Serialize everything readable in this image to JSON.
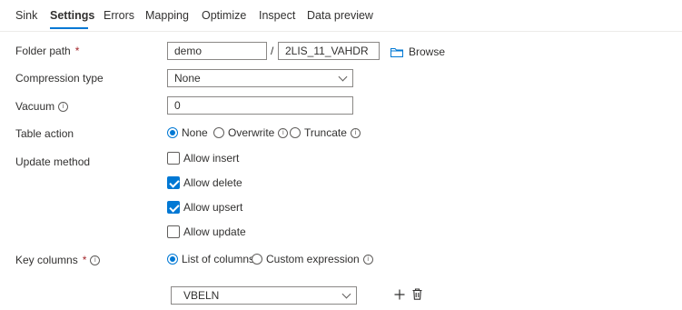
{
  "tabs": [
    {
      "label": "Sink"
    },
    {
      "label": "Settings"
    },
    {
      "label": "Errors"
    },
    {
      "label": "Mapping"
    },
    {
      "label": "Optimize"
    },
    {
      "label": "Inspect"
    },
    {
      "label": "Data preview"
    }
  ],
  "active_tab": "Settings",
  "folder_path": {
    "label": "Folder path",
    "required_mark": "*",
    "container_value": "demo",
    "separator": "/",
    "directory_value": "2LIS_11_VAHDR",
    "browse_label": "Browse"
  },
  "compression": {
    "label": "Compression type",
    "selected": "None"
  },
  "vacuum": {
    "label": "Vacuum",
    "value": "0"
  },
  "table_action": {
    "label": "Table action",
    "options": [
      {
        "label": "None",
        "selected": true
      },
      {
        "label": "Overwrite",
        "selected": false
      },
      {
        "label": "Truncate",
        "selected": false
      }
    ]
  },
  "update_method": {
    "label": "Update method",
    "options": [
      {
        "label": "Allow insert",
        "checked": false
      },
      {
        "label": "Allow delete",
        "checked": true
      },
      {
        "label": "Allow upsert",
        "checked": true
      },
      {
        "label": "Allow update",
        "checked": false
      }
    ]
  },
  "key_columns": {
    "label": "Key columns",
    "required_mark": "*",
    "options": [
      {
        "label": "List of columns",
        "selected": true
      },
      {
        "label": "Custom expression",
        "selected": false
      }
    ],
    "column_value": "VBELN"
  },
  "icons": {
    "folder": "folder-icon",
    "info": "info-icon",
    "add": "plus-icon",
    "delete": "trash-icon"
  },
  "colors": {
    "accent": "#0078d4",
    "text": "#323130",
    "required": "#a4262c",
    "border": "#8a8886"
  }
}
